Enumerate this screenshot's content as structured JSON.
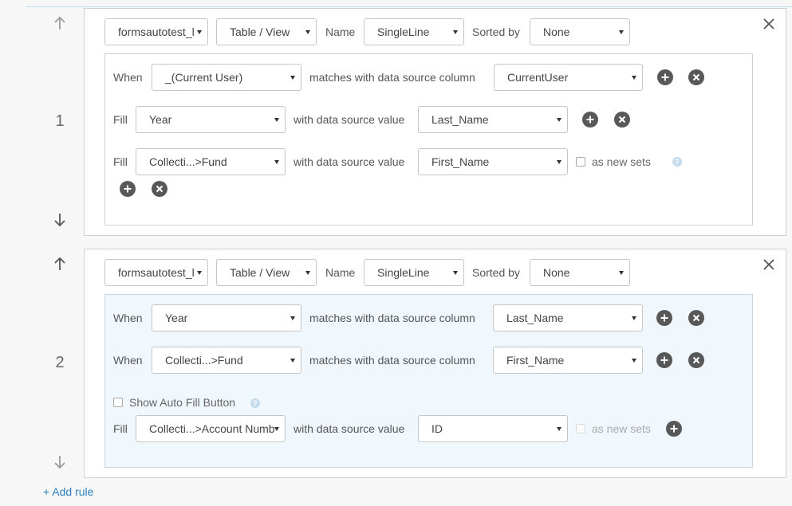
{
  "rules": [
    {
      "number": "1",
      "source": "formsautotest_l",
      "type": "Table / View",
      "name_label": "Name",
      "name_value": "SingleLine",
      "sorted_label": "Sorted by",
      "sorted_value": "None",
      "when_rows": [
        {
          "label": "When",
          "field": "_(Current User)",
          "mid": "matches with data source column",
          "column": "CurrentUser"
        }
      ],
      "fill_rows": [
        {
          "label": "Fill",
          "field": "Year",
          "mid": "with data source value",
          "value": "Last_Name"
        },
        {
          "label": "Fill",
          "field": "Collecti...>Fund",
          "mid": "with data source value",
          "value": "First_Name",
          "new_sets": "as new sets"
        }
      ]
    },
    {
      "number": "2",
      "source": "formsautotest_l",
      "type": "Table / View",
      "name_label": "Name",
      "name_value": "SingleLine",
      "sorted_label": "Sorted by",
      "sorted_value": "None",
      "when_rows": [
        {
          "label": "When",
          "field": "Year",
          "mid": "matches with data source column",
          "column": "Last_Name"
        },
        {
          "label": "When",
          "field": "Collecti...>Fund",
          "mid": "matches with data source column",
          "column": "First_Name"
        }
      ],
      "show_auto_fill": "Show Auto Fill Button",
      "fill_rows": [
        {
          "label": "Fill",
          "field": "Collecti...>Account Numb",
          "mid": "with data source value",
          "value": "ID",
          "new_sets": "as new sets"
        }
      ]
    }
  ],
  "add_rule": "+ Add rule",
  "help_glyph": "?",
  "colors": {
    "link": "#2d7fc2",
    "icon_dark": "#585858",
    "conditions_bg_active": "#f0f7fd"
  }
}
